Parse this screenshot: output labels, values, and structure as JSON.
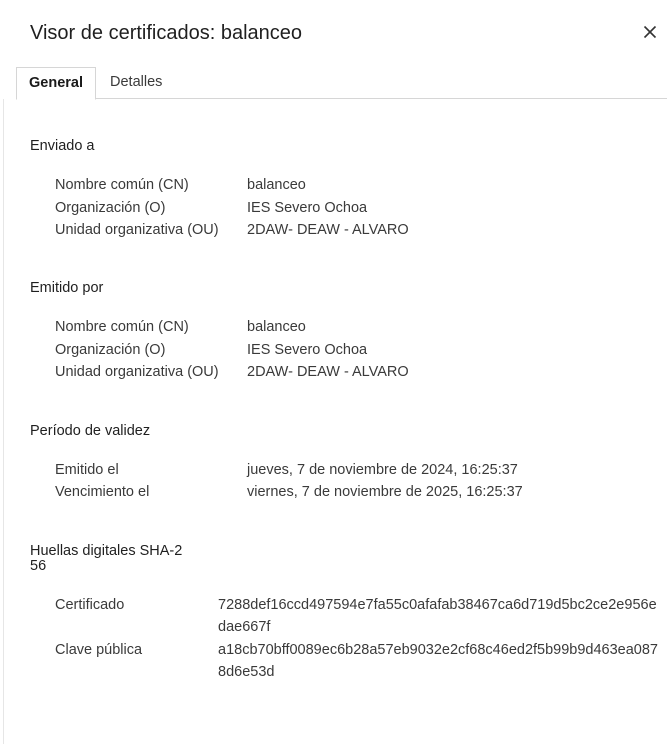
{
  "dialog": {
    "title": "Visor de certificados: balanceo"
  },
  "tabs": [
    {
      "label": "General",
      "selected": true
    },
    {
      "label": "Detalles",
      "selected": false
    }
  ],
  "subject": {
    "heading": "Enviado a",
    "rows": [
      {
        "label": "Nombre común (CN)",
        "value": "balanceo"
      },
      {
        "label": "Organización (O)",
        "value": "IES Severo Ochoa"
      },
      {
        "label": "Unidad organizativa (OU)",
        "value": "2DAW- DEAW - ALVARO"
      }
    ]
  },
  "issuer": {
    "heading": "Emitido por",
    "rows": [
      {
        "label": "Nombre común (CN)",
        "value": "balanceo"
      },
      {
        "label": "Organización (O)",
        "value": "IES Severo Ochoa"
      },
      {
        "label": "Unidad organizativa (OU)",
        "value": "2DAW- DEAW - ALVARO"
      }
    ]
  },
  "validity": {
    "heading": "Período de validez",
    "rows": [
      {
        "label": "Emitido el",
        "value": "jueves, 7 de noviembre de 2024, 16:25:37"
      },
      {
        "label": "Vencimiento el",
        "value": "viernes, 7 de noviembre de 2025, 16:25:37"
      }
    ]
  },
  "fingerprints": {
    "heading": "Huellas digitales SHA-256",
    "rows": [
      {
        "label": "Certificado",
        "value": "7288def16ccd497594e7fa55c0afafab38467ca6d719d5bc2ce2e956edae667f"
      },
      {
        "label": "Clave pública",
        "value": "a18cb70bff0089ec6b28a57eb9032e2cf68c46ed2f5b99b9d463ea0878d6e53d"
      }
    ]
  },
  "icons": {
    "close": "close-icon"
  }
}
